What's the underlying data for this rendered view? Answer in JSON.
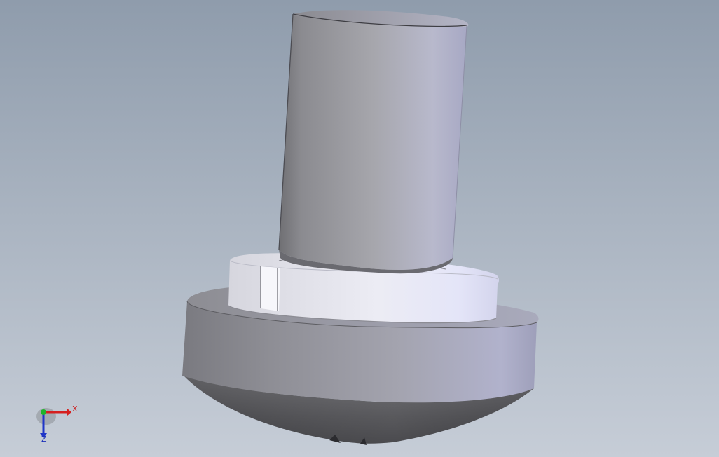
{
  "viewport": {
    "background_top": "#8f9cac",
    "background_bottom": "#c6cdd7",
    "part": {
      "components": [
        "cylinder-shaft",
        "collar-ring",
        "collar-slot",
        "base-flange",
        "domed-bottom"
      ],
      "shaded_color": "#a9aab6",
      "highlight_color": "#e6e8f4"
    }
  },
  "triad": {
    "x_label": "X",
    "z_label": "Z",
    "x_color": "#d51f1f",
    "y_color": "#1fb42a",
    "z_color": "#1f35c8"
  }
}
